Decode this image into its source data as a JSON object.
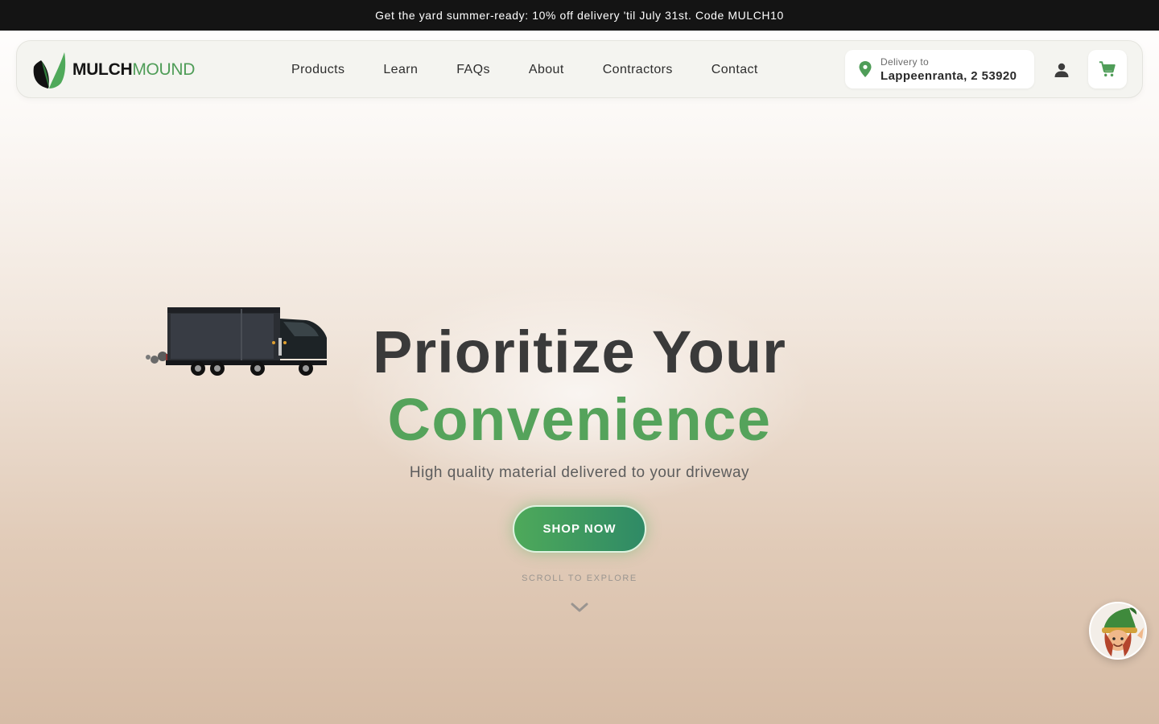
{
  "promo": {
    "text": "Get the yard summer-ready: 10% off delivery 'til July 31st. Code MULCH10"
  },
  "brand": {
    "part1": "MULCH",
    "part2": "MOUND",
    "accent_color": "#4f9d58"
  },
  "nav": {
    "items": [
      {
        "label": "Products"
      },
      {
        "label": "Learn"
      },
      {
        "label": "FAQs"
      },
      {
        "label": "About"
      },
      {
        "label": "Contractors"
      },
      {
        "label": "Contact"
      }
    ]
  },
  "delivery": {
    "label": "Delivery to",
    "location": "Lappeenranta, 2 53920",
    "icon": "map-pin-icon"
  },
  "header_icons": {
    "account": "user-icon",
    "cart": "shopping-cart-icon"
  },
  "hero": {
    "headline_line1": "Prioritize Your",
    "headline_line2": "Convenience",
    "subtitle": "High quality material delivered to your driveway",
    "cta_label": "SHOP NOW",
    "scroll_hint": "SCROLL TO EXPLORE",
    "illustration": "dump-truck-icon"
  },
  "chat": {
    "icon": "gnome-assistant-icon"
  },
  "colors": {
    "promo_bg": "#141414",
    "headline_dark": "#3a3a3a",
    "headline_green": "#55a35b",
    "cta_start": "#4ea95a",
    "cta_end": "#2f8a66"
  }
}
